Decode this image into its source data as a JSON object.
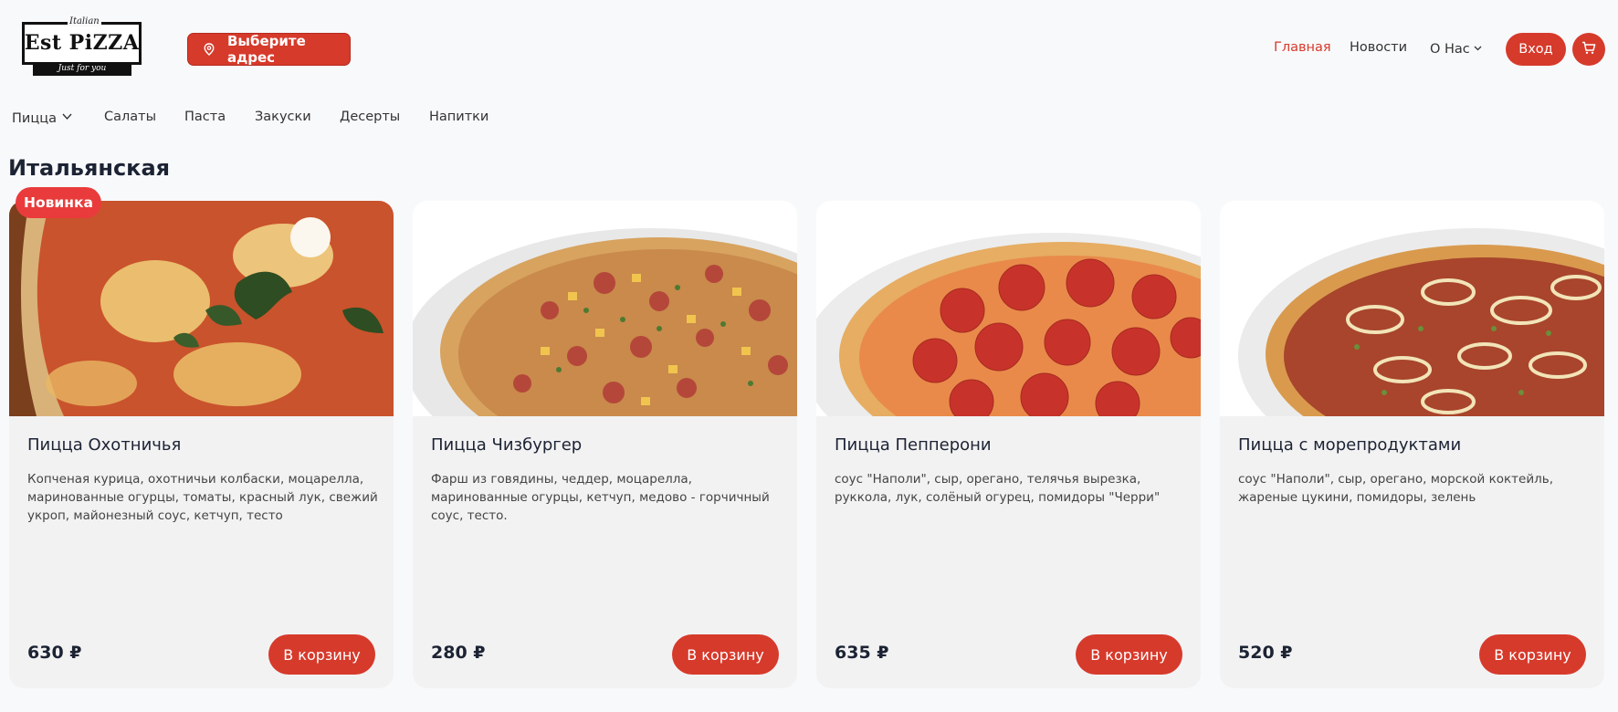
{
  "logo": {
    "top": "Italian",
    "main": "Est PiZZA",
    "strip": "Just for you"
  },
  "header": {
    "address_button": "Выберите адрес",
    "nav": {
      "home": "Главная",
      "news": "Новости",
      "about": "О Нас"
    },
    "login": "Вход",
    "icons": {
      "address": "map-pin-icon",
      "cart": "cart-icon",
      "dropdown": "chevron-down-icon"
    }
  },
  "categories": [
    "Пицца",
    "Салаты",
    "Паста",
    "Закуски",
    "Десерты",
    "Напитки"
  ],
  "section_title": "Итальянская",
  "badge": "Новинка",
  "colors": {
    "accent": "#d63a2b",
    "badge": "#e93b3b"
  },
  "products": [
    {
      "name": "Пицца Охотничья",
      "desc": "Копченая курица, охотничьи колбаски, моцарелла, маринованные огурцы, томаты, красный лук, свежий укроп, майонезный соус, кетчуп, тесто",
      "price": "630 ₽",
      "button": "В корзину"
    },
    {
      "name": "Пицца Чизбургер",
      "desc": "Фарш из говядины, чеддер, моцарелла, маринованные огурцы, кетчуп, медово - горчичный соус, тесто.",
      "price": "280 ₽",
      "button": "В корзину"
    },
    {
      "name": "Пицца Пепперони",
      "desc": "соус \"Наполи\", сыр, орегано, телячья вырезка, руккола, лук, солёный огурец, помидоры \"Черри\"",
      "price": "635 ₽",
      "button": "В корзину"
    },
    {
      "name": "Пицца с морепродуктами",
      "desc": "соус \"Наполи\", сыр, орегано, морской коктейль, жареные цукини, помидоры, зелень",
      "price": "520 ₽",
      "button": "В корзину"
    }
  ]
}
